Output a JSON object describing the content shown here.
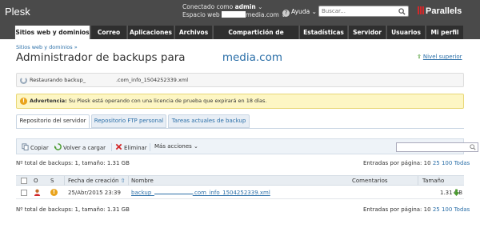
{
  "header": {
    "logo": "Plesk",
    "connected_prefix": "Conectado como",
    "user": "admin",
    "webspace_prefix": "Espacio web",
    "webspace_suffix": "media.com",
    "help": "Ayuda",
    "search_placeholder": "Buscar...",
    "brand": "Parallels"
  },
  "tabs": [
    {
      "label": "Sitios web y dominios"
    },
    {
      "label": "Correo"
    },
    {
      "label": "Aplicaciones"
    },
    {
      "label": "Archivos"
    },
    {
      "label": "Compartición de archivos"
    },
    {
      "label": "Estadísticas"
    },
    {
      "label": "Servidor"
    },
    {
      "label": "Usuarios"
    },
    {
      "label": "Mi perfil"
    }
  ],
  "breadcrumb": "Sitios web y dominios »",
  "page": {
    "title_prefix": "Administrador de backups para",
    "title_domain": "media.com",
    "up_link": "Nivel superior"
  },
  "restore_msg": {
    "prefix": "Restaurando backup_",
    "suffix": ".com_info_1504252339.xml"
  },
  "warning": {
    "label": "Advertencia:",
    "text": "Su Plesk está operando con una licencia de prueba que expirará en 18 días."
  },
  "subtabs": [
    {
      "label": "Repositorio del servidor"
    },
    {
      "label": "Repositorio FTP personal"
    },
    {
      "label": "Tareas actuales de backup"
    }
  ],
  "toolbar": {
    "copy": "Copiar",
    "restore": "Volver a cargar",
    "delete": "Eliminar",
    "more": "Más acciones"
  },
  "summary": {
    "text": "Nº total de backups: 1, tamaño: 1.31 GB",
    "per_page_label": "Entradas por página:",
    "options": [
      "10",
      "25",
      "100",
      "Todas"
    ]
  },
  "table": {
    "headers": {
      "o": "O",
      "s": "S",
      "date": "Fecha de creación",
      "sort": "⇧",
      "name": "Nombre",
      "comments": "Comentarios",
      "size": "Tamaño"
    },
    "rows": [
      {
        "date": "25/Abr/2015 23:39",
        "name_prefix": "backup_",
        "name_suffix": ".com_info_1504252339.xml",
        "comments": "",
        "size": "1.31 GB"
      }
    ]
  },
  "colors": {
    "topbar": "#4a4a4a",
    "link": "#2b6fa8",
    "warning_bg": "#fdf6c4",
    "accent_red": "#d3282a",
    "green": "#4a9b2f"
  }
}
